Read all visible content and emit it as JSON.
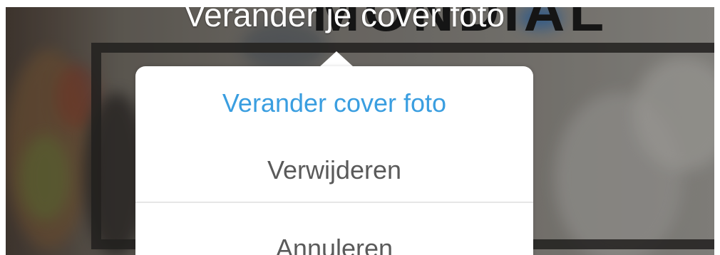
{
  "cover": {
    "caption": "Verander je cover foto",
    "logo_text": "MONDIAL"
  },
  "action_sheet": {
    "items": [
      {
        "label": "Verander cover foto",
        "color": "#3a9ee0"
      },
      {
        "label": "Verwijderen",
        "color": "#5a5a5a"
      },
      {
        "label": "Annuleren",
        "color": "#5a5a5a"
      }
    ]
  }
}
